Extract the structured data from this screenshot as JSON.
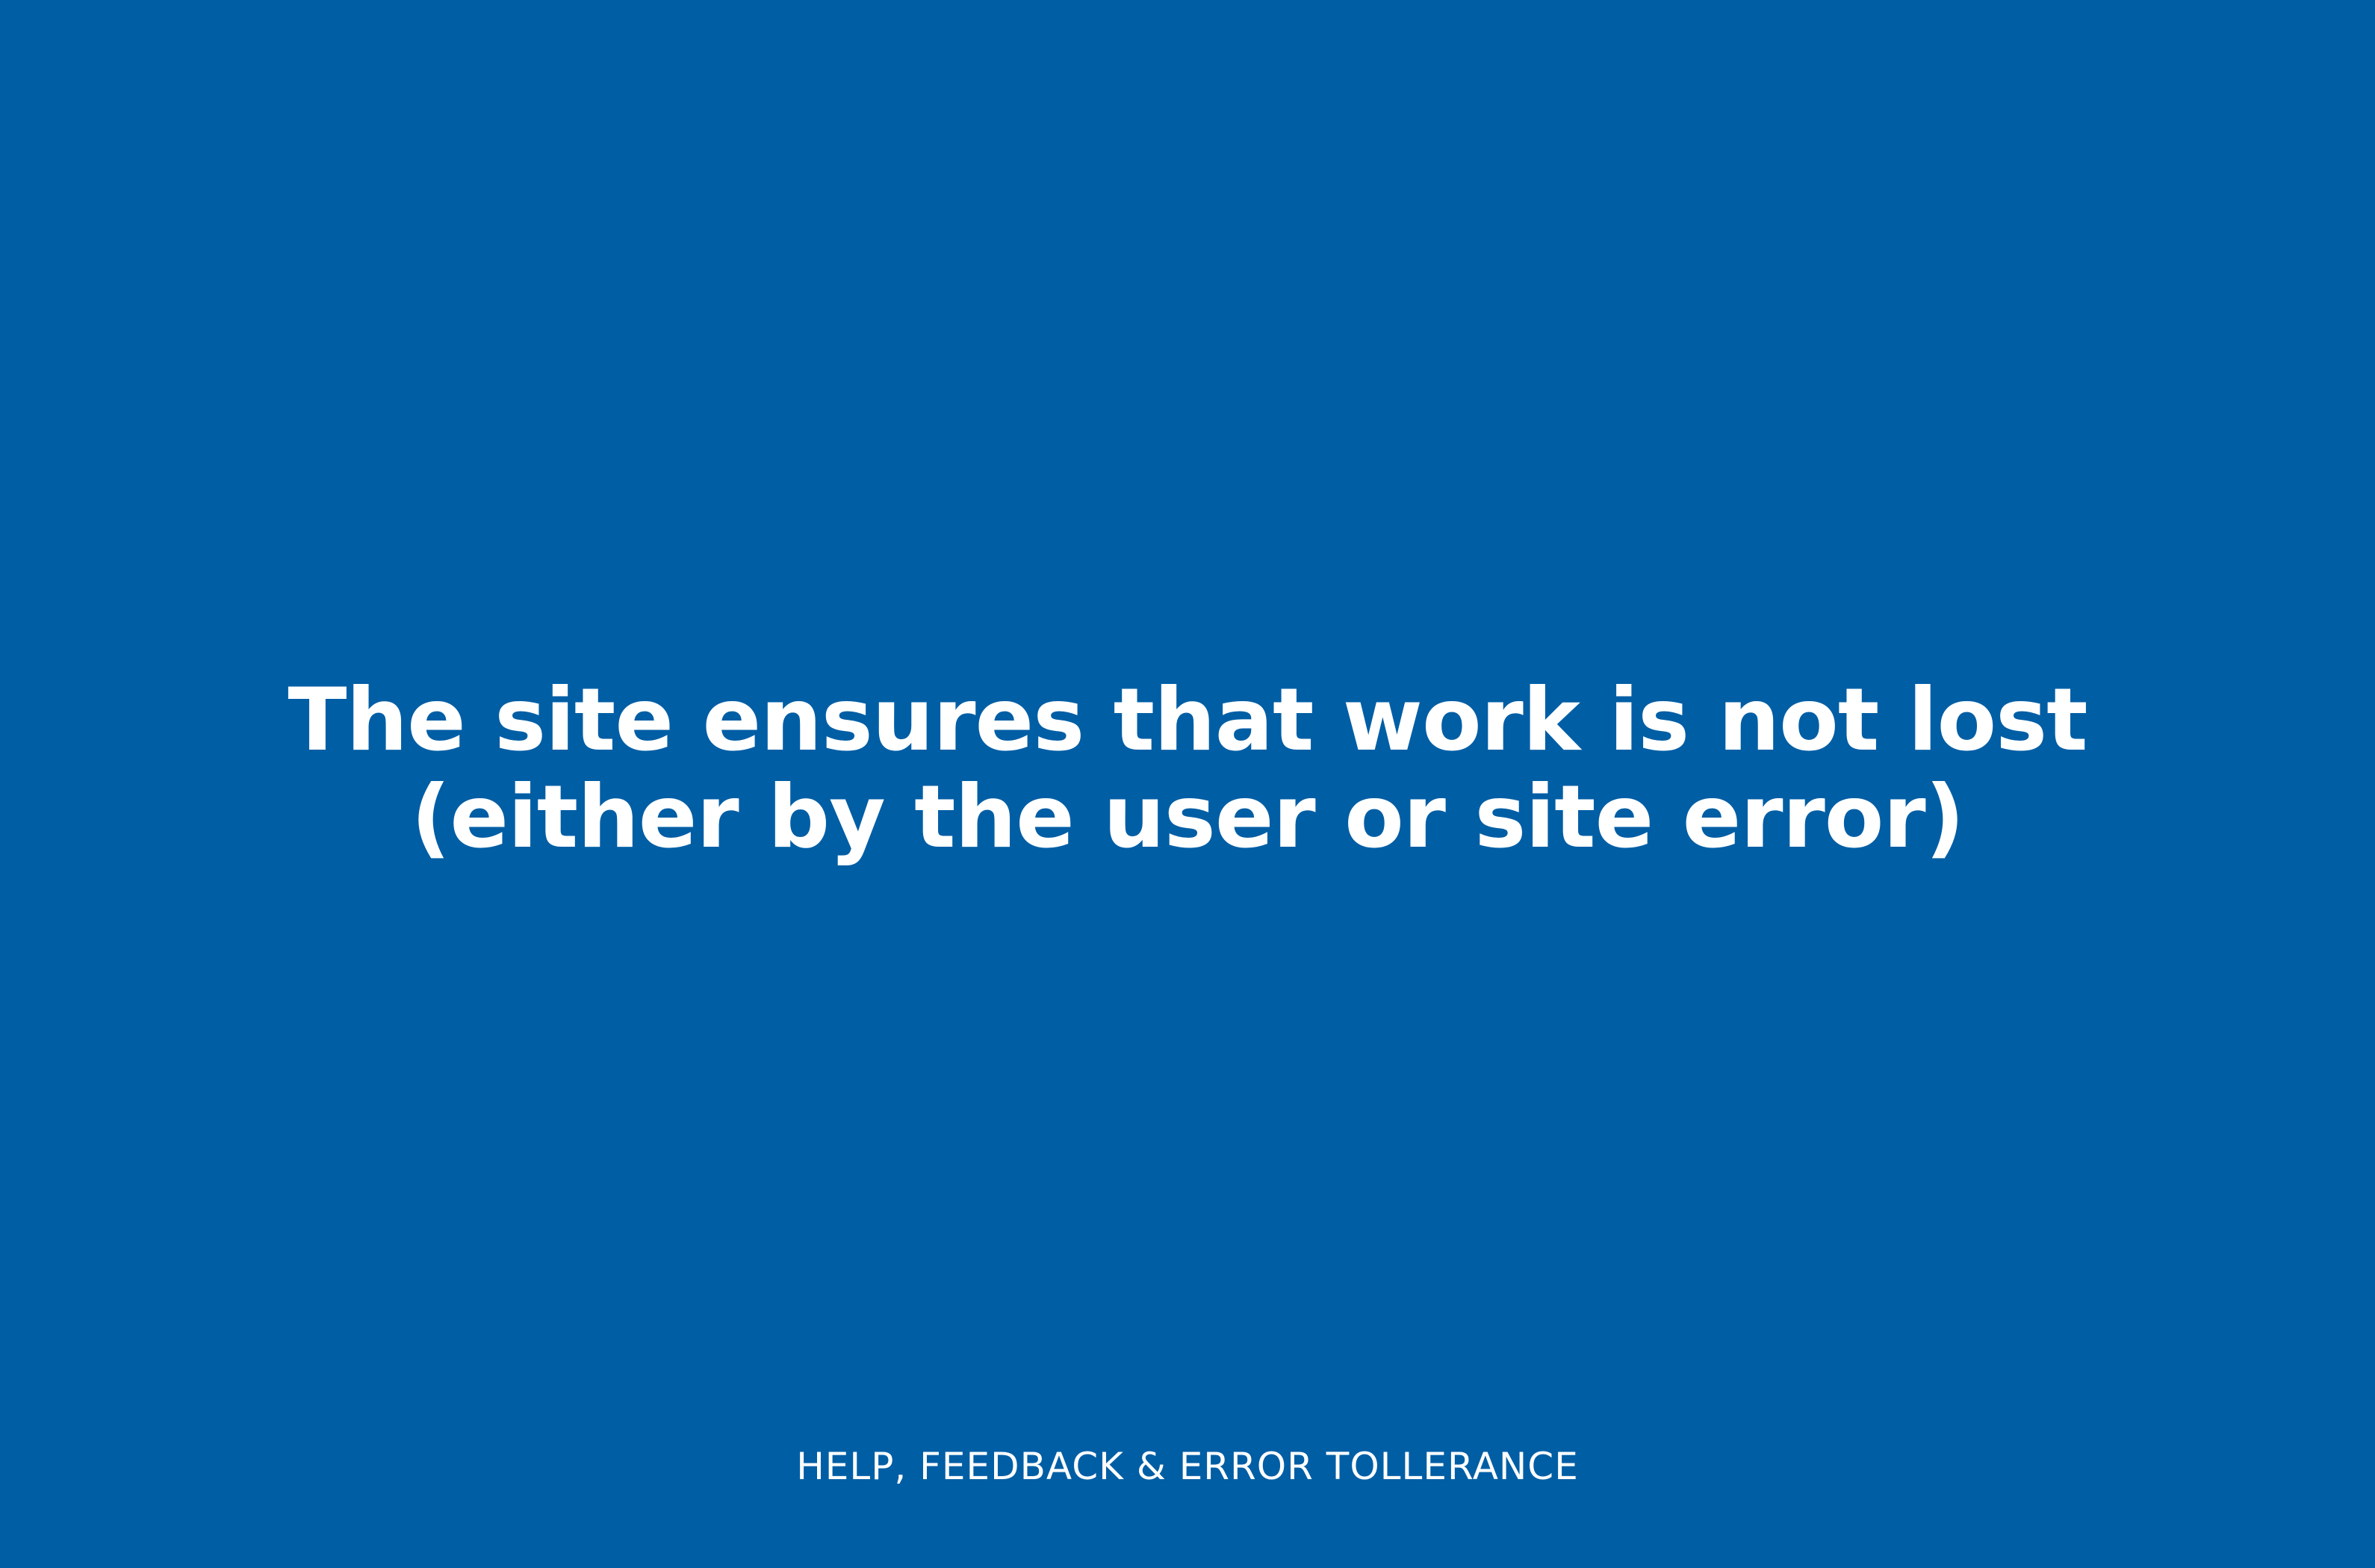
{
  "slide": {
    "statement_lines": [
      "The site ensures that work is not lost",
      "(either by the user or site error)"
    ],
    "section_label": "HELP, FEEDBACK & ERROR TOLLERANCE"
  },
  "colors": {
    "background": "#005ea5",
    "text": "#ffffff"
  }
}
